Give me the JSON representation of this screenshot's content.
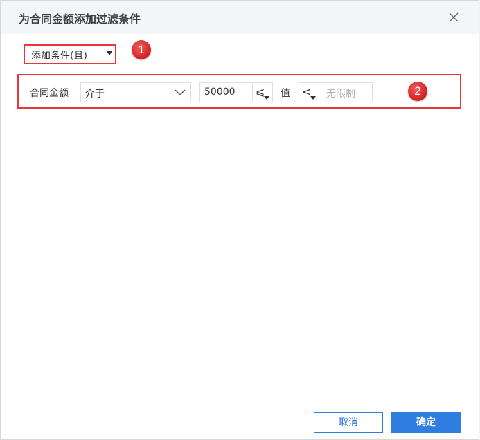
{
  "dialog": {
    "title": "为合同金额添加过滤条件",
    "close_icon": "close-icon"
  },
  "add_condition": {
    "label": "添加条件(且)",
    "caret_icon": "caret-down-icon",
    "badge": "1"
  },
  "condition": {
    "field": "合同金额",
    "operator": "介于",
    "operator_chevron_icon": "chevron-down-icon",
    "lower_value": "50000",
    "lower_comparator": "⩽",
    "middle_label": "值",
    "upper_comparator": "<",
    "upper_placeholder": "无限制",
    "badge": "2"
  },
  "footer": {
    "cancel_label": "取消",
    "ok_label": "确定"
  },
  "colors": {
    "accent": "#2f7de1",
    "highlight": "#e5383b"
  }
}
